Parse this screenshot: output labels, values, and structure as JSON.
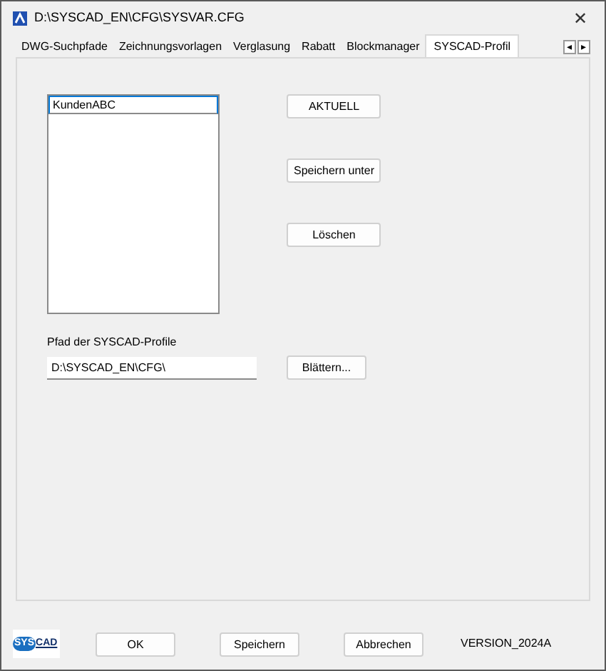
{
  "window": {
    "title": "D:\\SYSCAD_EN\\CFG\\SYSVAR.CFG",
    "close": "✕"
  },
  "tabs": [
    {
      "label": "DWG-Suchpfade",
      "selected": false
    },
    {
      "label": "Zeichnungsvorlagen",
      "selected": false
    },
    {
      "label": "Verglasung",
      "selected": false
    },
    {
      "label": "Rabatt",
      "selected": false
    },
    {
      "label": "Blockmanager",
      "selected": false
    },
    {
      "label": "SYSCAD-Profil",
      "selected": true
    }
  ],
  "tab_scroll": [
    "◂",
    "▸"
  ],
  "profiles": {
    "items": [
      {
        "label": "KundenABC",
        "selected": true
      }
    ]
  },
  "side_buttons": [
    "AKTUELL",
    "Speichern unter",
    "Löschen"
  ],
  "path": {
    "label": "Pfad der SYSCAD-Profile",
    "value": "D:\\SYSCAD_EN\\CFG\\",
    "browse": "Blättern..."
  },
  "footer": {
    "logo": [
      "SYS",
      "CAD"
    ],
    "buttons": [
      "OK",
      "Speichern",
      "Abbrechen"
    ],
    "version": "VERSION_2024A"
  }
}
